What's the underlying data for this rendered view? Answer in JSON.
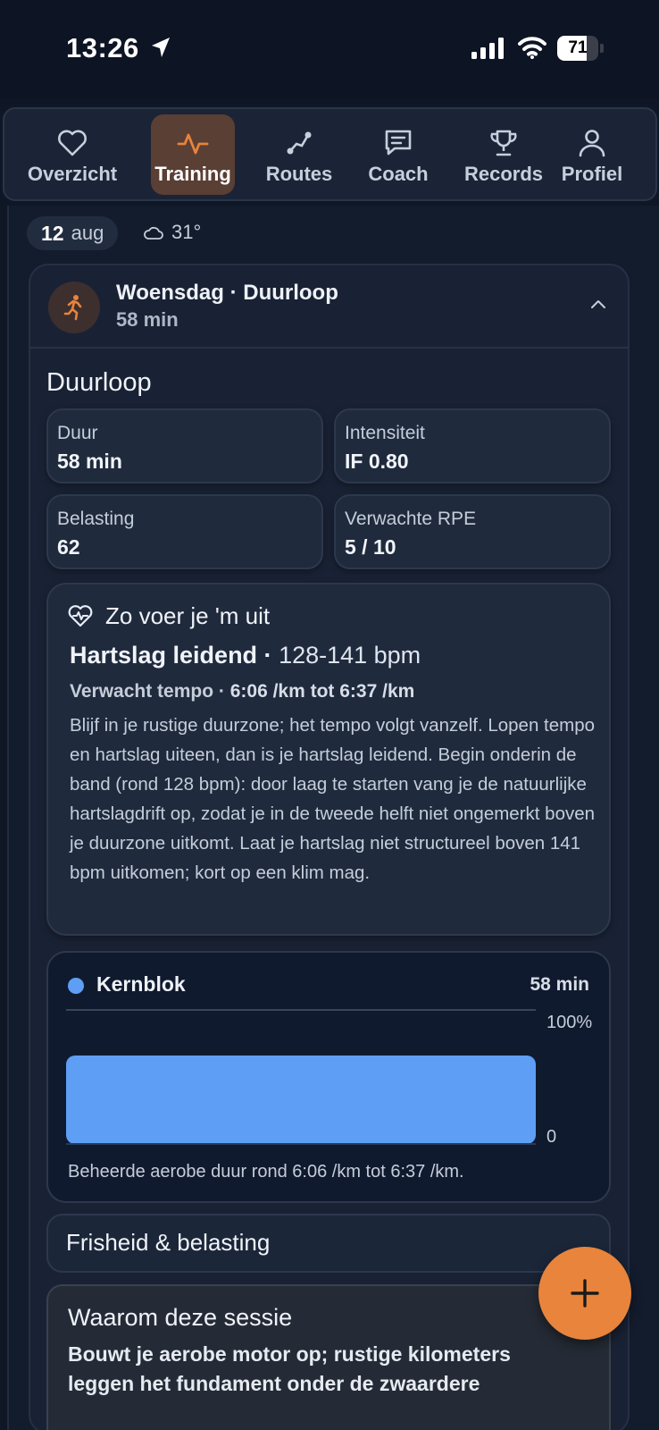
{
  "status_bar": {
    "time": "13:26",
    "battery": "71",
    "battery_level": 0.71
  },
  "nav": {
    "tabs": [
      {
        "label": "Overzicht",
        "icon": "heart-icon",
        "active": false
      },
      {
        "label": "Training",
        "icon": "activity-pulse-icon",
        "active": true
      },
      {
        "label": "Routes",
        "icon": "route-icon",
        "active": false
      },
      {
        "label": "Coach",
        "icon": "chat-bubble-icon",
        "active": false
      },
      {
        "label": "Records",
        "icon": "trophy-icon",
        "active": false
      },
      {
        "label": "Profiel",
        "icon": "user-icon",
        "active": false
      }
    ]
  },
  "day": {
    "date_day": "12",
    "date_month": "aug",
    "temperature": "31°",
    "weather_icon": "cloud-icon"
  },
  "session": {
    "title": "Woensdag · Duurloop",
    "duration": "58 min",
    "section_title": "Duurloop",
    "stats": [
      {
        "label": "Duur",
        "value": "58 min"
      },
      {
        "label": "Intensiteit",
        "value": "IF 0.80"
      },
      {
        "label": "Belasting",
        "value": "62"
      },
      {
        "label": "Verwachte RPE",
        "value": "5 / 10"
      }
    ]
  },
  "guide": {
    "title": "Zo voer je 'm uit",
    "hr_label": "Hartslag leidend · ",
    "hr_range": "128-141 bpm",
    "tempo_label": "Verwacht tempo · ",
    "tempo_value": "6:06 /km tot 6:37 /km",
    "text": "Blijf in je rustige duurzone; het tempo volgt vanzelf. Lopen tempo en hartslag uiteen, dan is je hartslag leidend. Begin onderin de band (rond 128 bpm): door laag te starten vang je de natuurlijke hartslagdrift op, zodat je in de tweede helft niet ongemerkt boven je duurzone uitkomt. Laat je hartslag niet structureel boven 141 bpm uitkomen; kort op een klim mag."
  },
  "block": {
    "name": "Kernblok",
    "duration": "58 min",
    "description": "Beheerde aerobe duur rond 6:06 /km tot 6:37 /km.",
    "color": "#5e9ff5"
  },
  "chart_data": {
    "type": "bar",
    "categories": [
      "Kernblok"
    ],
    "values": [
      100
    ],
    "y_tick_labels": [
      "100%",
      "0"
    ],
    "ylim": [
      0,
      100
    ]
  },
  "freshness": {
    "title": "Frisheid & belasting"
  },
  "why": {
    "title": "Waarom deze sessie",
    "text": "Bouwt je aerobe motor op; rustige kilometers leggen het fundament onder de zwaardere"
  },
  "colors": {
    "accent": "#e8843c",
    "background": "#0f1626",
    "block": "#5e9ff5"
  }
}
